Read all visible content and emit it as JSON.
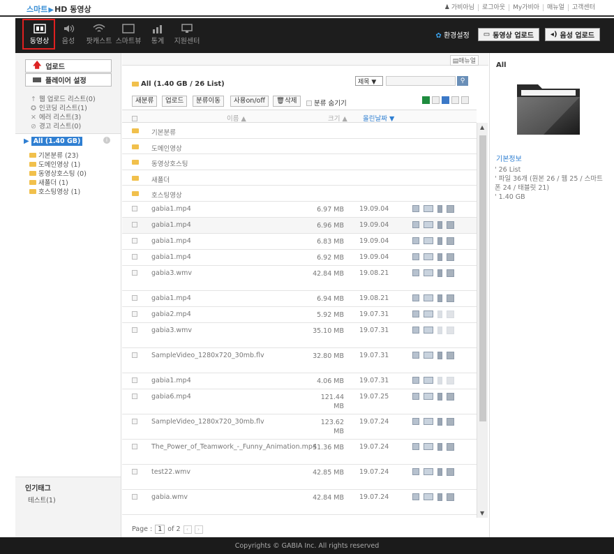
{
  "app": {
    "logo_prefix": "스마트",
    "logo_main": "HD 동영상"
  },
  "toplinks": [
    "가비아님",
    "로그아웃",
    "My가비아",
    "매뉴얼",
    "고객센터"
  ],
  "nav": {
    "items": [
      {
        "label": "동영상",
        "icon": "film-icon"
      },
      {
        "label": "음성",
        "icon": "speaker-icon"
      },
      {
        "label": "팟캐스트",
        "icon": "wifi-icon"
      },
      {
        "label": "스마트뷰",
        "icon": "monitor-icon"
      },
      {
        "label": "통계",
        "icon": "chart-icon"
      },
      {
        "label": "지원센터",
        "icon": "desktop-icon"
      }
    ],
    "settings_label": "환경설정",
    "video_upload_label": "동영상 업로드",
    "audio_upload_label": "음성 업로드"
  },
  "sidebar": {
    "upload_label": "업로드",
    "player_settings_label": "플레이어 설정",
    "status_items": [
      "웹 업로드 리스트(0)",
      "인코딩 리스트(1)",
      "에러 리스트(3)",
      "경고 리스트(0)"
    ],
    "tree_root": "All (1.40 GB)",
    "tree_children": [
      "기본분류 (23)",
      "도메인영상 (1)",
      "동영상호스팅 (0)",
      "새폴더 (1)",
      "호스팅영상 (1)"
    ],
    "popular_tags_title": "인기태그",
    "popular_tags": [
      "테스트(1)"
    ]
  },
  "center": {
    "manual_label": "매뉴얼",
    "title": "All (1.40 GB / 26 List)",
    "sort_value": "제목 ▼",
    "toolbar": [
      "새분류",
      "업로드",
      "분류이동",
      "사용on/off",
      "삭제"
    ],
    "hide_category_label": "분류 숨기기",
    "columns": {
      "name": "이름 ▲",
      "size": "크기 ▲",
      "date": "올린날짜 ▼"
    },
    "folders": [
      "기본분류",
      "도메인영상",
      "동영상호스팅",
      "새폴더",
      "호스팅영상"
    ],
    "files": [
      {
        "name": "gabia1.mp4",
        "size": "6.97 MB",
        "date": "19.09.04"
      },
      {
        "name": "gabia1.mp4",
        "size": "6.96 MB",
        "date": "19.09.04"
      },
      {
        "name": "gabia1.mp4",
        "size": "6.83 MB",
        "date": "19.09.04"
      },
      {
        "name": "gabia1.mp4",
        "size": "6.92 MB",
        "date": "19.09.04"
      },
      {
        "name": "gabia3.wmv",
        "size": "42.84 MB",
        "date": "19.08.21"
      },
      {
        "name": "gabia1.mp4",
        "size": "6.94 MB",
        "date": "19.08.21"
      },
      {
        "name": "gabia2.mp4",
        "size": "5.92 MB",
        "date": "19.07.31"
      },
      {
        "name": "gabia3.wmv",
        "size": "35.10 MB",
        "date": "19.07.31"
      },
      {
        "name": "SampleVideo_1280x720_30mb.flv",
        "size": "32.80 MB",
        "date": "19.07.31"
      },
      {
        "name": "gabia1.mp4",
        "size": "4.06 MB",
        "date": "19.07.31"
      },
      {
        "name": "gabia6.mp4",
        "size": "121.44 MB",
        "date": "19.07.25"
      },
      {
        "name": "SampleVideo_1280x720_30mb.flv",
        "size": "123.62 MB",
        "date": "19.07.24"
      },
      {
        "name": "The_Power_of_Teamwork_-_Funny_Animation.mp4",
        "size": "51.36 MB",
        "date": "19.07.24"
      },
      {
        "name": "test22.wmv",
        "size": "42.85 MB",
        "date": "19.07.24"
      },
      {
        "name": "gabia.wmv",
        "size": "42.84 MB",
        "date": "19.07.24"
      }
    ],
    "pager": {
      "label": "Page :",
      "current": "1",
      "of": "of 2"
    }
  },
  "right": {
    "title": "All",
    "info_title": "기본정보",
    "info": [
      "' 26 List",
      "' 파일 36개 (원본 26 / 웹 25 / 스마트폰 24 / 태블릿 21)",
      "' 1.40 GB"
    ]
  },
  "footer": "Copyrights © GABIA Inc. All rights reserved"
}
